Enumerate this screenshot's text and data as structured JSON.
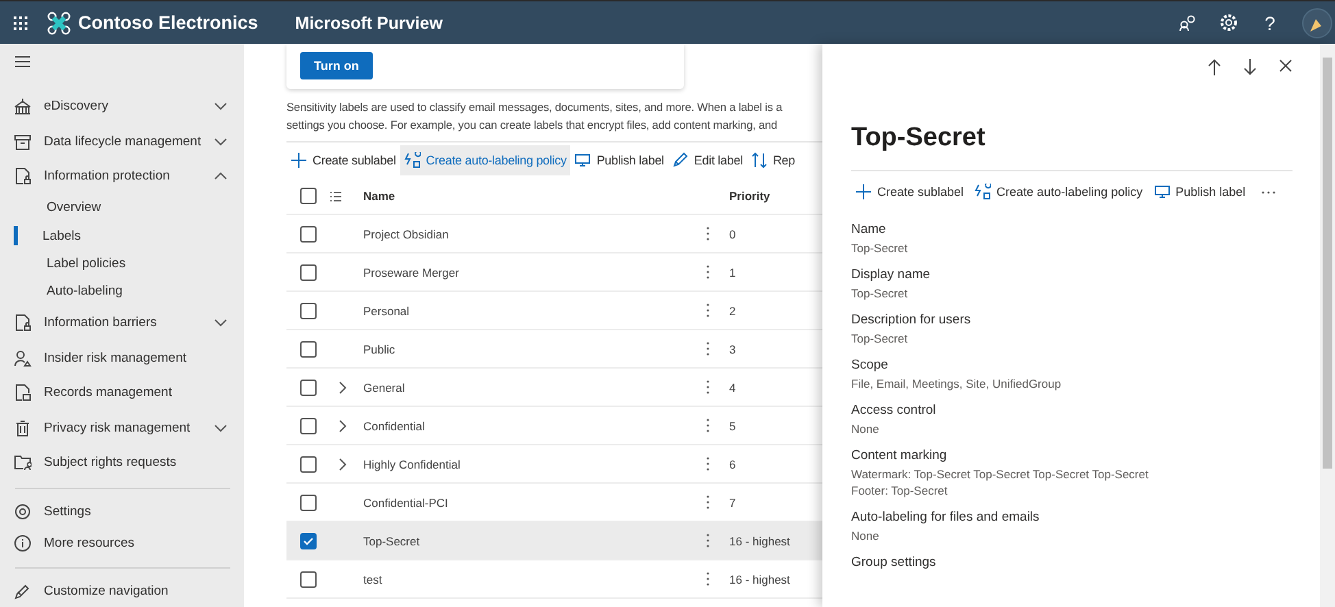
{
  "header": {
    "org": "Contoso Electronics",
    "app": "Microsoft Purview",
    "help": "?"
  },
  "sidebar": {
    "items": [
      {
        "label": "eDiscovery",
        "kind": "group",
        "expanded": false
      },
      {
        "label": "Data lifecycle management",
        "kind": "group",
        "expanded": false
      },
      {
        "label": "Information protection",
        "kind": "group",
        "expanded": true,
        "children": [
          {
            "label": "Overview",
            "selected": false
          },
          {
            "label": "Labels",
            "selected": true
          },
          {
            "label": "Label policies",
            "selected": false
          },
          {
            "label": "Auto-labeling",
            "selected": false
          }
        ]
      },
      {
        "label": "Information barriers",
        "kind": "group",
        "expanded": false
      },
      {
        "label": "Insider risk management",
        "kind": "link"
      },
      {
        "label": "Records management",
        "kind": "link"
      },
      {
        "label": "Privacy risk management",
        "kind": "group",
        "expanded": false
      },
      {
        "label": "Subject rights requests",
        "kind": "link"
      }
    ],
    "footer_items": [
      {
        "label": "Settings"
      },
      {
        "label": "More resources"
      }
    ],
    "customize": {
      "label": "Customize navigation"
    }
  },
  "main": {
    "turn_on_button": "Turn on",
    "description": [
      "Sensitivity labels are used to classify email messages, documents, sites, and more. When a label is a",
      "settings you choose. For example, you can create labels that encrypt files, add content marking, and"
    ],
    "toolbar": [
      {
        "label": "Create sublabel",
        "hovered": false
      },
      {
        "label": "Create auto-labeling policy",
        "hovered": true
      },
      {
        "label": "Publish label",
        "hovered": false
      },
      {
        "label": "Edit label",
        "hovered": false
      },
      {
        "label": "Rep",
        "hovered": false
      }
    ],
    "table": {
      "select_all": {
        "checked": false
      },
      "columns": [
        "Name",
        "Priority"
      ],
      "rows": [
        {
          "name": "Project Obsidian",
          "priority": "0",
          "kind": "label",
          "selected": false
        },
        {
          "name": "Proseware Merger",
          "priority": "1",
          "kind": "label",
          "selected": false
        },
        {
          "name": "Personal",
          "priority": "2",
          "kind": "label",
          "selected": false
        },
        {
          "name": "Public",
          "priority": "3",
          "kind": "label",
          "selected": false
        },
        {
          "name": "General",
          "priority": "4",
          "kind": "parent",
          "expanded": false,
          "selected": false
        },
        {
          "name": "Confidential",
          "priority": "5",
          "kind": "parent",
          "expanded": false,
          "selected": false
        },
        {
          "name": "Highly Confidential",
          "priority": "6",
          "kind": "parent",
          "expanded": false,
          "selected": false
        },
        {
          "name": "Confidential-PCI",
          "priority": "7",
          "kind": "label",
          "selected": false
        },
        {
          "name": "Top-Secret",
          "priority": "16 - highest",
          "kind": "label",
          "selected": true
        },
        {
          "name": "test",
          "priority": "16 - highest",
          "kind": "label",
          "selected": false
        }
      ]
    }
  },
  "panel": {
    "title": "Top-Secret",
    "actions": [
      "Create sublabel",
      "Create auto-labeling policy",
      "Publish label"
    ],
    "fields": [
      {
        "label": "Name",
        "values": [
          "Top-Secret"
        ]
      },
      {
        "label": "Display name",
        "values": [
          "Top-Secret"
        ]
      },
      {
        "label": "Description for users",
        "values": [
          "Top-Secret"
        ]
      },
      {
        "label": "Scope",
        "values": [
          "File, Email, Meetings, Site, UnifiedGroup"
        ]
      },
      {
        "label": "Access control",
        "values": [
          "None"
        ]
      },
      {
        "label": "Content marking",
        "values": [
          "Watermark: Top-Secret Top-Secret Top-Secret Top-Secret",
          "Footer: Top-Secret"
        ]
      },
      {
        "label": "Auto-labeling for files and emails",
        "values": [
          "None"
        ]
      },
      {
        "label": "Group settings"
      }
    ]
  }
}
